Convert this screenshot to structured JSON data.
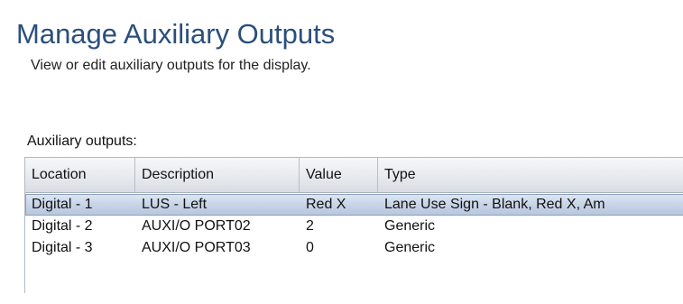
{
  "page": {
    "title": "Manage Auxiliary Outputs",
    "subtitle": "View or edit auxiliary outputs for the display."
  },
  "outputs": {
    "label": "Auxiliary outputs:",
    "columns": [
      "Location",
      "Description",
      "Value",
      "Type"
    ],
    "rows": [
      {
        "location": "Digital - 1",
        "description": "LUS - Left",
        "value": "Red X",
        "type": "Lane Use Sign - Blank, Red X, Am",
        "selected": true
      },
      {
        "location": "Digital - 2",
        "description": "AUXI/O PORT02",
        "value": "2",
        "type": "Generic",
        "selected": false
      },
      {
        "location": "Digital - 3",
        "description": "AUXI/O PORT03",
        "value": "0",
        "type": "Generic",
        "selected": false
      }
    ]
  },
  "colors": {
    "title": "#2b4f7d",
    "selected_row": "#c7d4e7",
    "header_bg": "#e7eaee"
  }
}
